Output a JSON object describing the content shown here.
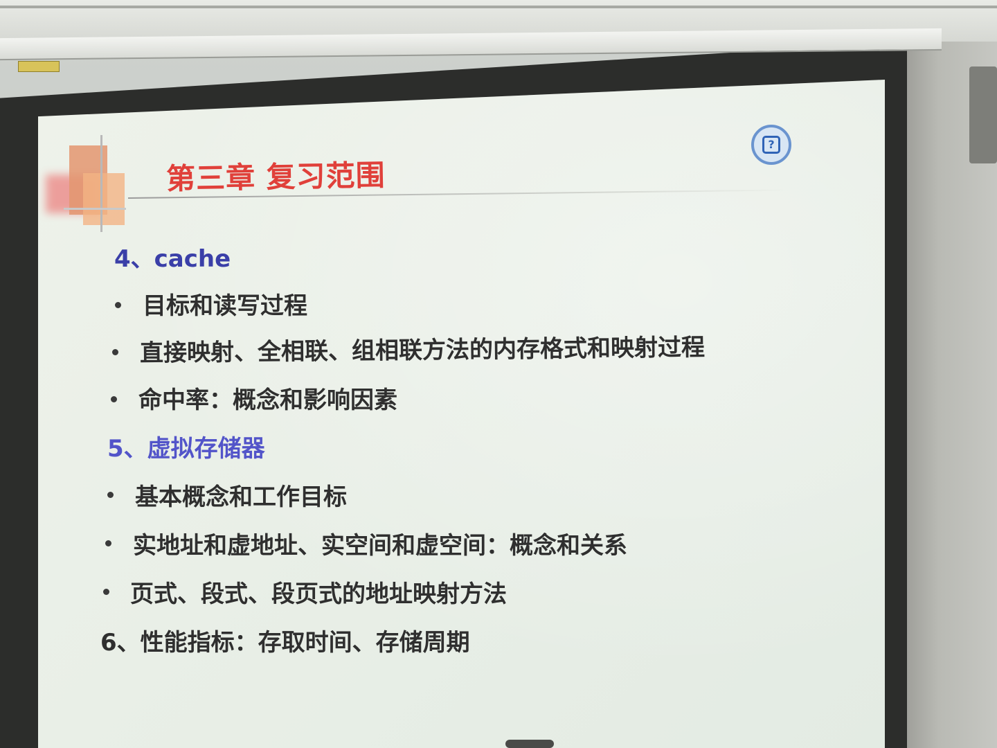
{
  "slide": {
    "title": "第三章  复习范围",
    "logo_icon": "question-badge-icon",
    "items": [
      {
        "kind": "section",
        "text": "4、cache"
      },
      {
        "kind": "bullet",
        "text": "目标和读写过程"
      },
      {
        "kind": "bullet",
        "text": "直接映射、全相联、组相联方法的内存格式和映射过程"
      },
      {
        "kind": "bullet",
        "text": "命中率：概念和影响因素"
      },
      {
        "kind": "section",
        "text": "5、虚拟存储器"
      },
      {
        "kind": "bullet",
        "text": "基本概念和工作目标"
      },
      {
        "kind": "bullet",
        "text": "实地址和虚地址、实空间和虚空间：概念和关系"
      },
      {
        "kind": "bullet",
        "text": "页式、段式、段页式的地址映射方法"
      },
      {
        "kind": "plain",
        "text": "6、性能指标：存取时间、存储周期"
      }
    ],
    "colors": {
      "title": "#e0403a",
      "section": "#3a3fa8",
      "body": "#2f2f2f"
    }
  }
}
